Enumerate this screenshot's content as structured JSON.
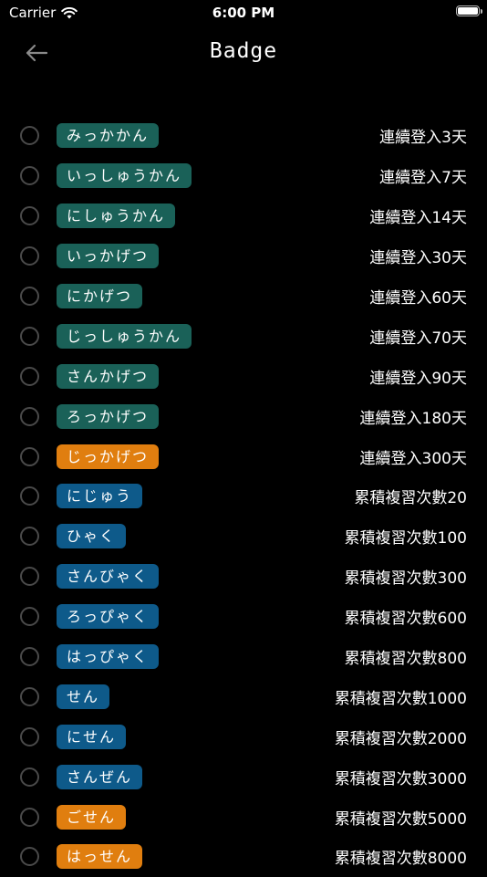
{
  "status_bar": {
    "carrier": "Carrier",
    "time": "6:00 PM"
  },
  "nav": {
    "title": "Badge",
    "back_icon": "arrow-left-icon"
  },
  "colors": {
    "background": "#000000",
    "teal": "#1a6158",
    "orange": "#e07e0f",
    "blue": "#0e5a8a",
    "radio_border": "#4a4a4a"
  },
  "badges": [
    {
      "label": "みっかかん",
      "requirement": "連續登入3天",
      "color": "teal"
    },
    {
      "label": "いっしゅうかん",
      "requirement": "連續登入7天",
      "color": "teal"
    },
    {
      "label": "にしゅうかん",
      "requirement": "連續登入14天",
      "color": "teal"
    },
    {
      "label": "いっかげつ",
      "requirement": "連續登入30天",
      "color": "teal"
    },
    {
      "label": "にかげつ",
      "requirement": "連續登入60天",
      "color": "teal"
    },
    {
      "label": "じっしゅうかん",
      "requirement": "連續登入70天",
      "color": "teal"
    },
    {
      "label": "さんかげつ",
      "requirement": "連續登入90天",
      "color": "teal"
    },
    {
      "label": "ろっかげつ",
      "requirement": "連續登入180天",
      "color": "teal"
    },
    {
      "label": "じっかげつ",
      "requirement": "連續登入300天",
      "color": "orange"
    },
    {
      "label": "にじゅう",
      "requirement": "累積複習次數20",
      "color": "blue"
    },
    {
      "label": "ひゃく",
      "requirement": "累積複習次數100",
      "color": "blue"
    },
    {
      "label": "さんびゃく",
      "requirement": "累積複習次數300",
      "color": "blue"
    },
    {
      "label": "ろっぴゃく",
      "requirement": "累積複習次數600",
      "color": "blue"
    },
    {
      "label": "はっぴゃく",
      "requirement": "累積複習次數800",
      "color": "blue"
    },
    {
      "label": "せん",
      "requirement": "累積複習次數1000",
      "color": "blue"
    },
    {
      "label": "にせん",
      "requirement": "累積複習次數2000",
      "color": "blue"
    },
    {
      "label": "さんぜん",
      "requirement": "累積複習次數3000",
      "color": "blue"
    },
    {
      "label": "ごせん",
      "requirement": "累積複習次數5000",
      "color": "orange"
    },
    {
      "label": "はっせん",
      "requirement": "累積複習次數8000",
      "color": "orange"
    }
  ]
}
